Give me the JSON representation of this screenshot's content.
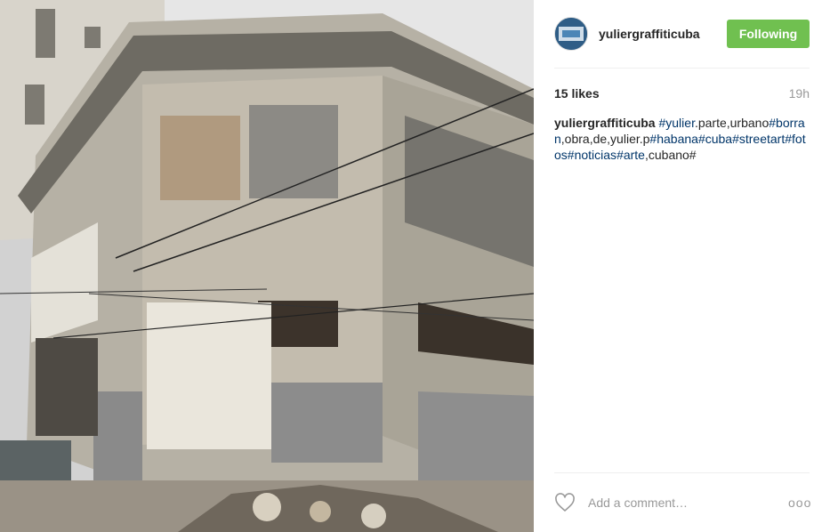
{
  "post": {
    "username": "yuliergraffiticuba",
    "follow_label": "Following",
    "likes": "15 likes",
    "time": "19h",
    "caption": {
      "user": "yuliergraffiticuba",
      "segments": [
        {
          "type": "tag",
          "text": "#yulier"
        },
        {
          "type": "text",
          "text": ".parte,urbano"
        },
        {
          "type": "tag",
          "text": "#borran"
        },
        {
          "type": "text",
          "text": ",obra,de,yulier.p"
        },
        {
          "type": "tag",
          "text": "#habana"
        },
        {
          "type": "tag",
          "text": "#cuba"
        },
        {
          "type": "tag",
          "text": "#streetart"
        },
        {
          "type": "tag",
          "text": "#fotos"
        },
        {
          "type": "tag",
          "text": "#noticias"
        },
        {
          "type": "tag",
          "text": "#arte"
        },
        {
          "type": "text",
          "text": ",cubano#"
        }
      ]
    },
    "comment_placeholder": "Add a comment…",
    "more_label": "ooo"
  },
  "colors": {
    "follow_green": "#70c050",
    "hashtag_blue": "#003569",
    "muted": "#999999"
  },
  "icons": {
    "like": "heart-outline-icon",
    "more": "ellipsis-icon"
  }
}
